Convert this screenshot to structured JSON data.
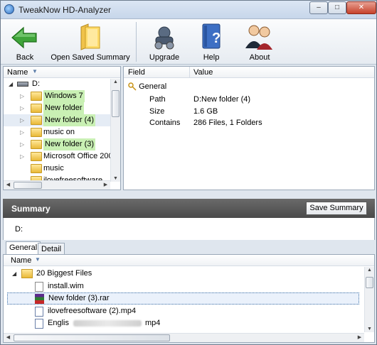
{
  "window": {
    "title": "TweakNow HD-Analyzer",
    "min_glyph": "–",
    "max_glyph": "□",
    "close_glyph": "✕"
  },
  "toolbar": {
    "back": "Back",
    "open_saved": "Open Saved Summary",
    "upgrade": "Upgrade",
    "help": "Help",
    "about": "About"
  },
  "tree": {
    "column": "Name",
    "drive": "D:",
    "items": [
      "Windows 7",
      "New folder",
      "New folder (4)",
      "music on",
      "New folder (3)",
      "Microsoft Office 200",
      "music",
      "ilovefreesoftware"
    ]
  },
  "properties": {
    "col_field": "Field",
    "col_value": "Value",
    "group": "General",
    "rows": [
      {
        "field": "Path",
        "value": "D:New folder (4)"
      },
      {
        "field": "Size",
        "value": "1.6 GB"
      },
      {
        "field": "Contains",
        "value": "286 Files, 1 Folders"
      }
    ]
  },
  "summary": {
    "title": "Summary",
    "save_button": "Save Summary",
    "path": "D:",
    "tabs": [
      "General",
      "Detail"
    ],
    "column": "Name",
    "group": "20 Biggest Files",
    "files": [
      "install.wim",
      "New folder (3).rar",
      "ilovefreesoftware (2).mp4",
      "Englis",
      "mp4"
    ]
  },
  "colors": {
    "highlight": "#c9f0b4",
    "summary_bar": "#555555",
    "back_arrow": "#3fa43a"
  }
}
